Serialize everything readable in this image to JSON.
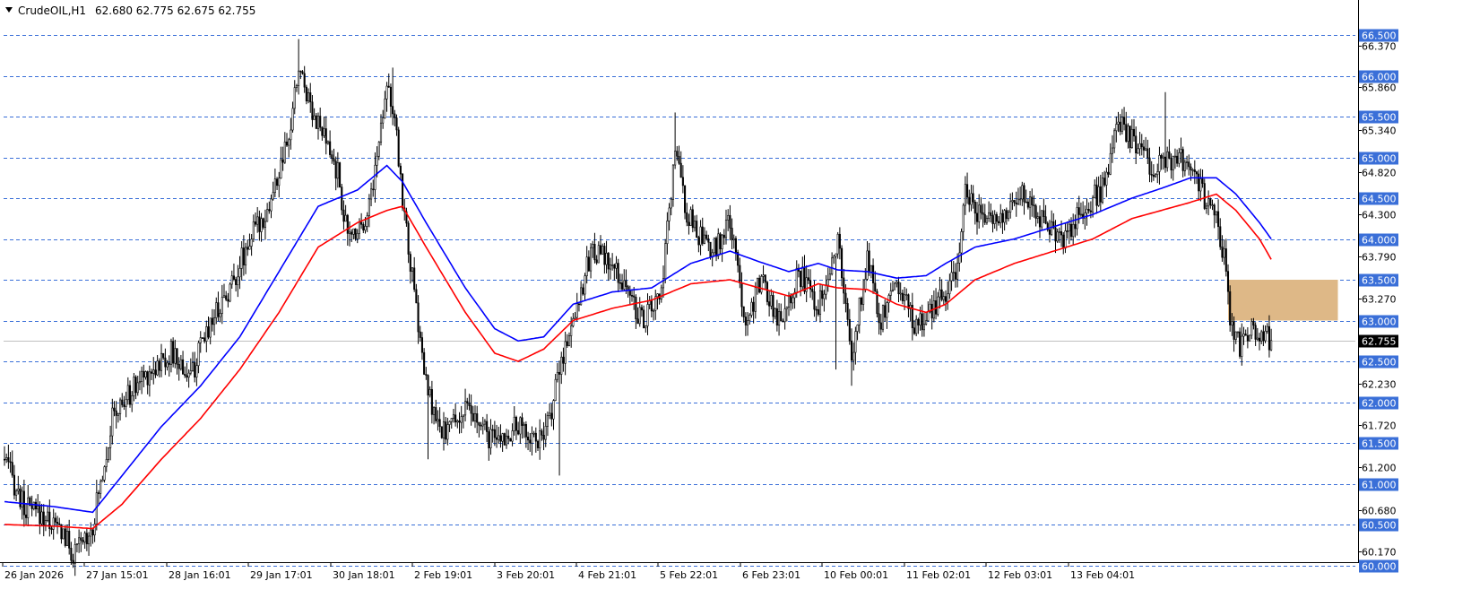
{
  "header": {
    "symbol_label": "CrudeOIL,H1",
    "ohlc_label": "62.680 62.775 62.675 62.755"
  },
  "colors": {
    "background": "#ffffff",
    "candle": "#000000",
    "grid": "#3a6fd8",
    "ema_fast": "#0000ff",
    "ema_slow": "#ff0000",
    "zone": "#deb887",
    "price_line": "#c0c0c0"
  },
  "chart_data": {
    "type": "candlestick",
    "timeframe": "H1",
    "ylim": [
      60.0,
      66.6
    ],
    "grid": true,
    "levels": [
      60.0,
      60.5,
      61.0,
      61.5,
      62.0,
      62.5,
      63.0,
      63.5,
      64.0,
      64.5,
      65.0,
      65.5,
      66.0,
      66.5
    ],
    "level_labels": [
      "60.000",
      "60.500",
      "61.000",
      "61.500",
      "62.000",
      "62.500",
      "63.000",
      "63.500",
      "64.000",
      "64.500",
      "65.000",
      "65.500",
      "66.000",
      "66.500"
    ],
    "minor_ticks": [
      60.17,
      60.68,
      61.2,
      61.72,
      62.23,
      63.27,
      63.79,
      64.3,
      64.82,
      65.34,
      65.86,
      66.37
    ],
    "minor_tick_labels": [
      "60.170",
      "60.680",
      "61.200",
      "61.720",
      "62.230",
      "63.270",
      "63.790",
      "64.300",
      "64.820",
      "65.340",
      "65.860",
      "66.370"
    ],
    "x_labels": [
      "26 Jan 2026",
      "27 Jan 15:01",
      "28 Jan 16:01",
      "29 Jan 17:01",
      "30 Jan 18:01",
      "2 Feb 19:01",
      "3 Feb 20:01",
      "4 Feb 21:01",
      "5 Feb 22:01",
      "6 Feb 23:01",
      "10 Feb 00:01",
      "11 Feb 02:01",
      "12 Feb 03:01",
      "13 Feb 04:01"
    ],
    "current_price": 62.755,
    "current_price_label": "62.755",
    "ohlc_anchors": [
      [
        0,
        61.3
      ],
      [
        10,
        60.7
      ],
      [
        20,
        60.6
      ],
      [
        30,
        60.4
      ],
      [
        35,
        60.1
      ],
      [
        45,
        60.5
      ],
      [
        55,
        61.8
      ],
      [
        70,
        62.3
      ],
      [
        85,
        62.6
      ],
      [
        95,
        62.3
      ],
      [
        105,
        63.0
      ],
      [
        115,
        63.4
      ],
      [
        125,
        64.0
      ],
      [
        135,
        64.4
      ],
      [
        145,
        65.2
      ],
      [
        150,
        66.1
      ],
      [
        160,
        65.4
      ],
      [
        170,
        64.8
      ],
      [
        175,
        64.0
      ],
      [
        185,
        64.3
      ],
      [
        190,
        65.0
      ],
      [
        195,
        66.0
      ],
      [
        200,
        65.2
      ],
      [
        203,
        64.5
      ],
      [
        208,
        63.5
      ],
      [
        215,
        62.2
      ],
      [
        222,
        61.6
      ],
      [
        235,
        61.9
      ],
      [
        250,
        61.5
      ],
      [
        262,
        61.7
      ],
      [
        275,
        61.5
      ],
      [
        285,
        62.6
      ],
      [
        300,
        63.9
      ],
      [
        315,
        63.5
      ],
      [
        325,
        63.0
      ],
      [
        335,
        63.3
      ],
      [
        342,
        65.1
      ],
      [
        348,
        64.3
      ],
      [
        360,
        63.8
      ],
      [
        370,
        64.2
      ],
      [
        378,
        63.0
      ],
      [
        386,
        63.5
      ],
      [
        395,
        63.0
      ],
      [
        405,
        63.6
      ],
      [
        415,
        63.2
      ],
      [
        425,
        64.0
      ],
      [
        432,
        62.5
      ],
      [
        440,
        63.8
      ],
      [
        447,
        63.0
      ],
      [
        455,
        63.5
      ],
      [
        465,
        62.9
      ],
      [
        475,
        63.2
      ],
      [
        485,
        63.5
      ],
      [
        490,
        64.6
      ],
      [
        500,
        64.2
      ],
      [
        510,
        64.3
      ],
      [
        520,
        64.6
      ],
      [
        530,
        64.2
      ],
      [
        540,
        64.0
      ],
      [
        550,
        64.4
      ],
      [
        560,
        64.6
      ],
      [
        568,
        65.4
      ],
      [
        575,
        65.2
      ],
      [
        585,
        64.9
      ],
      [
        600,
        64.95
      ],
      [
        610,
        64.6
      ],
      [
        618,
        64.2
      ],
      [
        622,
        63.8
      ],
      [
        625,
        63.0
      ],
      [
        630,
        62.7
      ],
      [
        636,
        62.9
      ],
      [
        643,
        62.8
      ],
      [
        646,
        62.755
      ]
    ],
    "wick_spikes": [
      [
        150,
        66.45
      ],
      [
        198,
        66.1
      ],
      [
        216,
        61.3
      ],
      [
        283,
        61.1
      ],
      [
        342,
        65.55
      ],
      [
        424,
        62.4
      ],
      [
        432,
        62.2
      ],
      [
        592,
        65.8
      ],
      [
        631,
        62.5
      ]
    ],
    "series": [
      {
        "period": 24,
        "anchors": [
          [
            0,
            60.78
          ],
          [
            25,
            60.72
          ],
          [
            45,
            60.65
          ],
          [
            60,
            61.1
          ],
          [
            80,
            61.7
          ],
          [
            100,
            62.2
          ],
          [
            120,
            62.8
          ],
          [
            140,
            63.6
          ],
          [
            160,
            64.4
          ],
          [
            180,
            64.6
          ],
          [
            195,
            64.9
          ],
          [
            203,
            64.7
          ],
          [
            215,
            64.2
          ],
          [
            235,
            63.4
          ],
          [
            250,
            62.9
          ],
          [
            262,
            62.75
          ],
          [
            275,
            62.8
          ],
          [
            290,
            63.2
          ],
          [
            310,
            63.35
          ],
          [
            330,
            63.4
          ],
          [
            350,
            63.7
          ],
          [
            370,
            63.85
          ],
          [
            385,
            63.72
          ],
          [
            400,
            63.6
          ],
          [
            415,
            63.7
          ],
          [
            425,
            63.62
          ],
          [
            440,
            63.6
          ],
          [
            455,
            63.52
          ],
          [
            470,
            63.55
          ],
          [
            480,
            63.7
          ],
          [
            495,
            63.9
          ],
          [
            515,
            64.0
          ],
          [
            535,
            64.15
          ],
          [
            555,
            64.3
          ],
          [
            575,
            64.5
          ],
          [
            590,
            64.62
          ],
          [
            605,
            64.75
          ],
          [
            618,
            64.75
          ],
          [
            628,
            64.55
          ],
          [
            640,
            64.2
          ],
          [
            646,
            64.0
          ]
        ]
      },
      {
        "period": 48,
        "anchors": [
          [
            0,
            60.5
          ],
          [
            25,
            60.48
          ],
          [
            45,
            60.45
          ],
          [
            60,
            60.75
          ],
          [
            80,
            61.3
          ],
          [
            100,
            61.8
          ],
          [
            120,
            62.4
          ],
          [
            140,
            63.1
          ],
          [
            160,
            63.9
          ],
          [
            180,
            64.2
          ],
          [
            195,
            64.35
          ],
          [
            203,
            64.4
          ],
          [
            215,
            63.9
          ],
          [
            235,
            63.1
          ],
          [
            250,
            62.6
          ],
          [
            262,
            62.5
          ],
          [
            275,
            62.65
          ],
          [
            290,
            63.0
          ],
          [
            310,
            63.15
          ],
          [
            330,
            63.25
          ],
          [
            350,
            63.45
          ],
          [
            370,
            63.5
          ],
          [
            385,
            63.4
          ],
          [
            400,
            63.3
          ],
          [
            415,
            63.45
          ],
          [
            425,
            63.4
          ],
          [
            440,
            63.38
          ],
          [
            455,
            63.2
          ],
          [
            470,
            63.1
          ],
          [
            480,
            63.2
          ],
          [
            495,
            63.5
          ],
          [
            515,
            63.7
          ],
          [
            535,
            63.85
          ],
          [
            555,
            64.0
          ],
          [
            575,
            64.25
          ],
          [
            590,
            64.35
          ],
          [
            605,
            64.45
          ],
          [
            618,
            64.55
          ],
          [
            628,
            64.35
          ],
          [
            640,
            64.0
          ],
          [
            646,
            63.75
          ]
        ]
      }
    ],
    "zones": [
      {
        "y_top": 63.5,
        "y_bottom": 63.0,
        "x_start": 624,
        "x_end": 680
      }
    ]
  }
}
